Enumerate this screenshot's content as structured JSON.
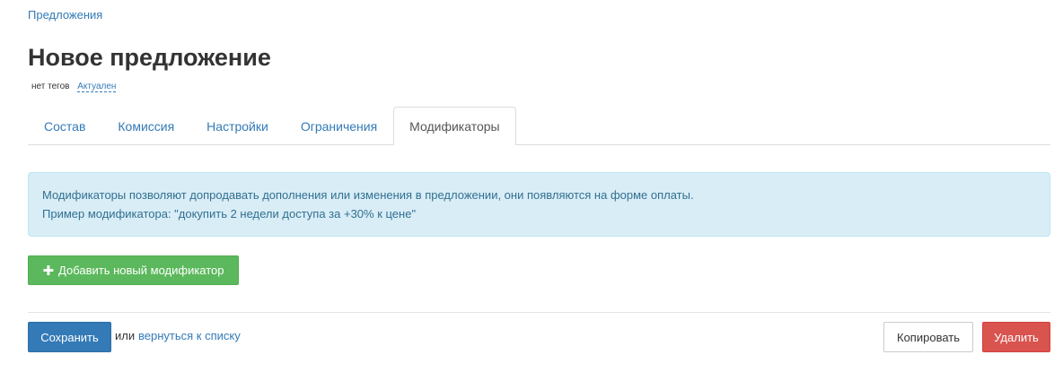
{
  "breadcrumb": {
    "label": "Предложения"
  },
  "page": {
    "title": "Новое предложение",
    "tags_text": "нет тегов",
    "status_text": "Актуален"
  },
  "tabs": [
    {
      "label": "Состав",
      "active": false
    },
    {
      "label": "Комиссия",
      "active": false
    },
    {
      "label": "Настройки",
      "active": false
    },
    {
      "label": "Ограничения",
      "active": false
    },
    {
      "label": "Модификаторы",
      "active": true
    }
  ],
  "info_alert": {
    "line1": "Модификаторы позволяют допродавать дополнения или изменения в предложении, они появляются на форме оплаты.",
    "line2": "Пример модификатора: \"докупить 2 недели доступа за +30% к цене\""
  },
  "add_modifier_button": {
    "icon": "plus-icon",
    "icon_glyph": "✚",
    "label": "Добавить новый модификатор"
  },
  "footer": {
    "save_label": "Сохранить",
    "or_text": "или",
    "back_link_label": "вернуться к списку",
    "copy_label": "Копировать",
    "delete_label": "Удалить"
  },
  "colors": {
    "link": "#337ab7",
    "primary": "#337ab7",
    "success": "#5cb85c",
    "danger": "#d9534f",
    "info_bg": "#d9edf7",
    "info_text": "#31708f"
  }
}
